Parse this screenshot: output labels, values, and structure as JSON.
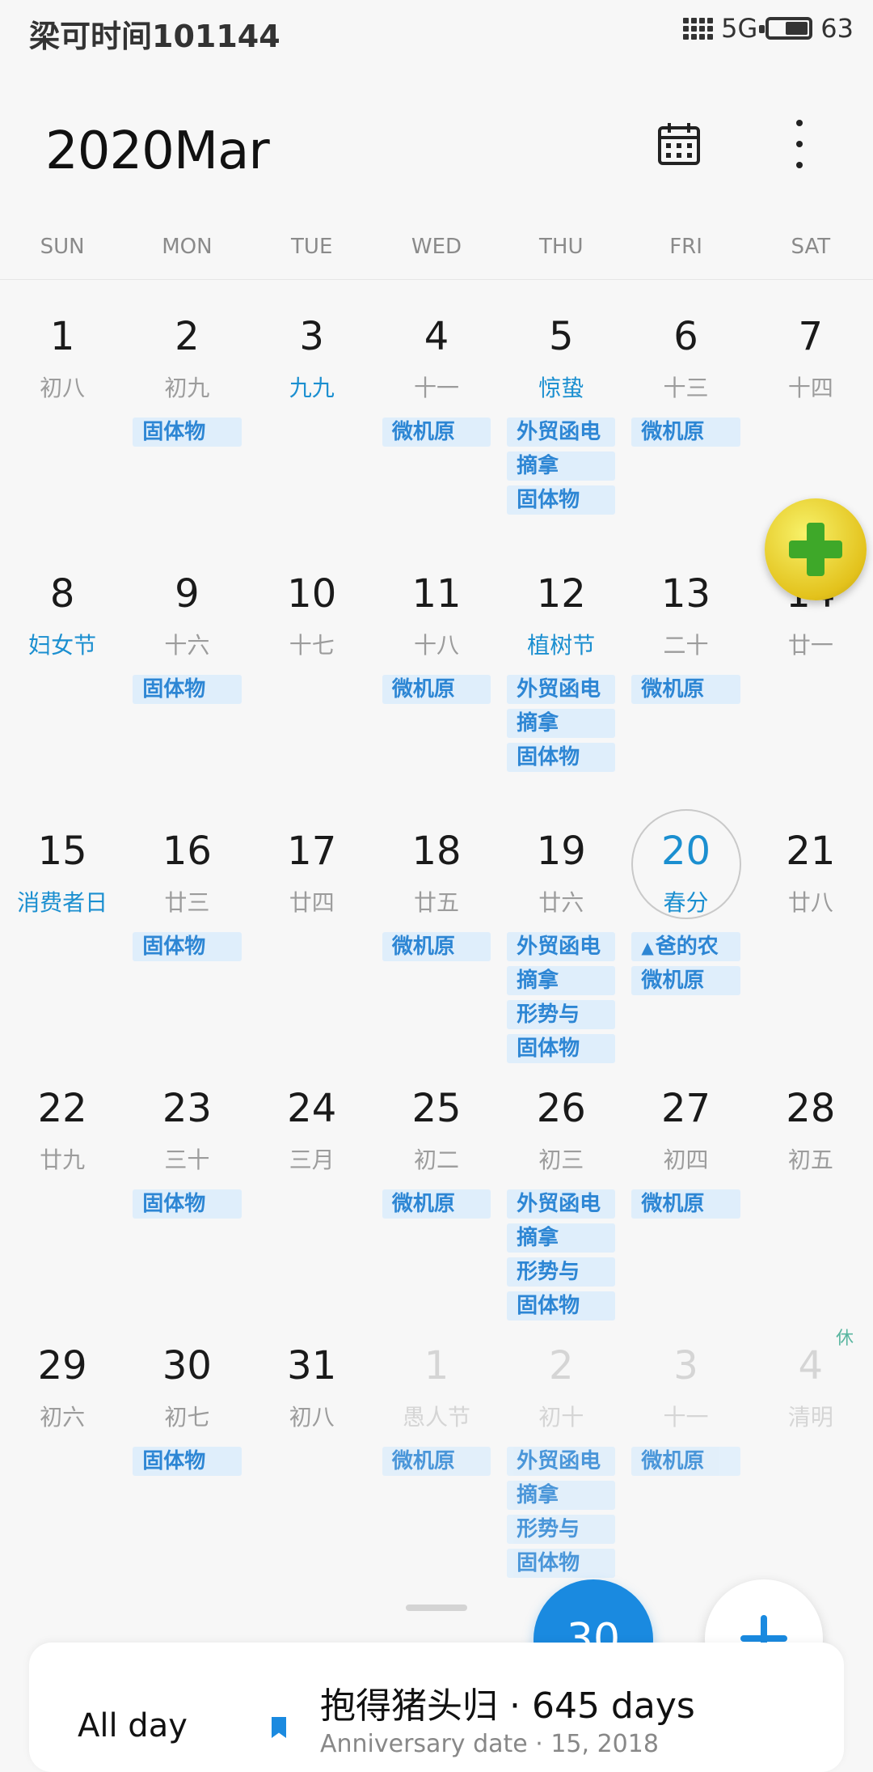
{
  "status_bar": {
    "carrier": "梁可时间101144",
    "network": "5G",
    "battery_text": "63",
    "battery_level": 0.63
  },
  "header": {
    "month_title": "2020Mar",
    "calendar_icon": "calendar-icon",
    "more_icon": "more-vertical-icon"
  },
  "weekdays": [
    "SUN",
    "MON",
    "TUE",
    "WED",
    "THU",
    "FRI",
    "SAT"
  ],
  "weeks": [
    {
      "days": [
        {
          "num": "1",
          "lunar": "初八",
          "type": "normal",
          "events": []
        },
        {
          "num": "2",
          "lunar": "初九",
          "type": "normal",
          "events": [
            "固体物"
          ]
        },
        {
          "num": "3",
          "lunar": "九九",
          "type": "festival",
          "events": []
        },
        {
          "num": "4",
          "lunar": "十一",
          "type": "normal",
          "events": [
            "微机原"
          ]
        },
        {
          "num": "5",
          "lunar": "惊蛰",
          "type": "festival",
          "events": [
            "外贸函电",
            "摘拿",
            "固体物"
          ]
        },
        {
          "num": "6",
          "lunar": "十三",
          "type": "normal",
          "events": [
            "微机原"
          ]
        },
        {
          "num": "7",
          "lunar": "十四",
          "type": "normal",
          "events": []
        }
      ]
    },
    {
      "days": [
        {
          "num": "8",
          "lunar": "妇女节",
          "type": "festival",
          "events": []
        },
        {
          "num": "9",
          "lunar": "十六",
          "type": "normal",
          "events": [
            "固体物"
          ]
        },
        {
          "num": "10",
          "lunar": "十七",
          "type": "normal",
          "events": []
        },
        {
          "num": "11",
          "lunar": "十八",
          "type": "normal",
          "events": [
            "微机原"
          ]
        },
        {
          "num": "12",
          "lunar": "植树节",
          "type": "festival",
          "events": [
            "外贸函电",
            "摘拿",
            "固体物"
          ]
        },
        {
          "num": "13",
          "lunar": "二十",
          "type": "normal",
          "events": [
            "微机原"
          ]
        },
        {
          "num": "14",
          "lunar": "廿一",
          "type": "normal",
          "events": []
        }
      ]
    },
    {
      "days": [
        {
          "num": "15",
          "lunar": "消费者日",
          "type": "festival",
          "events": []
        },
        {
          "num": "16",
          "lunar": "廿三",
          "type": "normal",
          "events": [
            "固体物"
          ]
        },
        {
          "num": "17",
          "lunar": "廿四",
          "type": "normal",
          "events": []
        },
        {
          "num": "18",
          "lunar": "廿五",
          "type": "normal",
          "events": [
            "微机原"
          ]
        },
        {
          "num": "19",
          "lunar": "廿六",
          "type": "normal",
          "events": [
            "外贸函电",
            "摘拿",
            "形势与",
            "固体物"
          ]
        },
        {
          "num": "20",
          "lunar": "春分",
          "type": "today",
          "events": [
            "爸的农",
            "微机原"
          ]
        },
        {
          "num": "21",
          "lunar": "廿八",
          "type": "normal",
          "events": []
        }
      ]
    },
    {
      "days": [
        {
          "num": "22",
          "lunar": "廿九",
          "type": "normal",
          "events": []
        },
        {
          "num": "23",
          "lunar": "三十",
          "type": "normal",
          "events": [
            "固体物"
          ]
        },
        {
          "num": "24",
          "lunar": "三月",
          "type": "normal",
          "events": []
        },
        {
          "num": "25",
          "lunar": "初二",
          "type": "normal",
          "events": [
            "微机原"
          ]
        },
        {
          "num": "26",
          "lunar": "初三",
          "type": "normal",
          "events": [
            "外贸函电",
            "摘拿",
            "形势与",
            "固体物"
          ]
        },
        {
          "num": "27",
          "lunar": "初四",
          "type": "normal",
          "events": [
            "微机原"
          ]
        },
        {
          "num": "28",
          "lunar": "初五",
          "type": "normal",
          "events": []
        }
      ]
    },
    {
      "days": [
        {
          "num": "29",
          "lunar": "初六",
          "type": "normal",
          "events": []
        },
        {
          "num": "30",
          "lunar": "初七",
          "type": "normal",
          "events": [
            "固体物"
          ]
        },
        {
          "num": "31",
          "lunar": "初八",
          "type": "normal",
          "events": []
        },
        {
          "num": "1",
          "lunar": "愚人节",
          "type": "other",
          "events": [
            "微机原"
          ]
        },
        {
          "num": "2",
          "lunar": "初十",
          "type": "other",
          "events": [
            "外贸函电",
            "摘拿",
            "形势与",
            "固体物"
          ]
        },
        {
          "num": "3",
          "lunar": "十一",
          "type": "other",
          "events": [
            "微机原"
          ]
        },
        {
          "num": "4",
          "lunar": "清明",
          "type": "other",
          "holiday": "休",
          "events": []
        }
      ]
    }
  ],
  "floating_icon": "plus-ball-icon",
  "buttons": {
    "today_label": "30",
    "add_icon": "plus-icon"
  },
  "bottom_sheet": {
    "all_day": "All day",
    "event_title": "抱得猪头归 · 645 days",
    "event_sub": "Anniversary date · 15, 2018"
  },
  "colors": {
    "accent": "#1a8ae0",
    "event_bg": "#dfeefb",
    "event_text": "#2d86d4",
    "festival_text": "#1b8fd0"
  }
}
